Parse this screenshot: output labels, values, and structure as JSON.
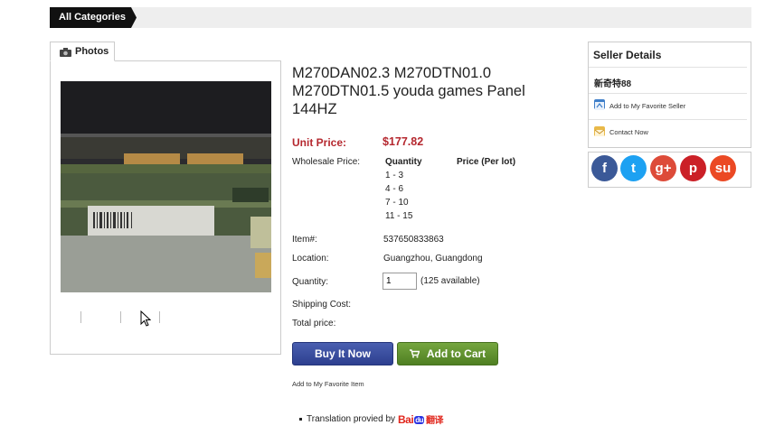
{
  "nav": {
    "all_categories": "All Categories"
  },
  "photos": {
    "tab_label": "Photos"
  },
  "product": {
    "title": "M270DAN02.3 M270DTN01.0 M270DTN01.5 youda games Panel 144HZ",
    "unit_price_label": "Unit Price:",
    "unit_price": "$177.82",
    "wholesale_label": "Wholesale Price:",
    "wholesale_qty_header": "Quantity",
    "wholesale_price_header": "Price (Per lot)",
    "wholesale_rows": [
      "1 - 3",
      "4 - 6",
      "7 - 10",
      "11 - 15"
    ],
    "item_label": "Item#:",
    "item_value": "537650833863",
    "location_label": "Location:",
    "location_value": "Guangzhou, Guangdong",
    "quantity_label": "Quantity:",
    "quantity_value": "1",
    "available": "(125 available)",
    "shipping_label": "Shipping Cost:",
    "total_label": "Total price:",
    "buy_now": "Buy It Now",
    "add_to_cart": "Add to Cart",
    "favorite_item": "Add to My Favorite Item"
  },
  "translation": {
    "text": "Translation provied by",
    "brand_a": "Bai",
    "brand_paw": "du",
    "brand_b": "翻译"
  },
  "seller": {
    "heading": "Seller Details",
    "name": "新奇特88",
    "favorite_seller": "Add to My Favorite Seller",
    "contact": "Contact Now"
  },
  "social": [
    {
      "name": "facebook-icon",
      "glyph": "f",
      "color": "#3b5998"
    },
    {
      "name": "twitter-icon",
      "glyph": "t",
      "color": "#1da1f2"
    },
    {
      "name": "google-plus-icon",
      "glyph": "g+",
      "color": "#dd4b39"
    },
    {
      "name": "pinterest-icon",
      "glyph": "p",
      "color": "#cb2027"
    },
    {
      "name": "stumbleupon-icon",
      "glyph": "su",
      "color": "#eb4924"
    }
  ]
}
